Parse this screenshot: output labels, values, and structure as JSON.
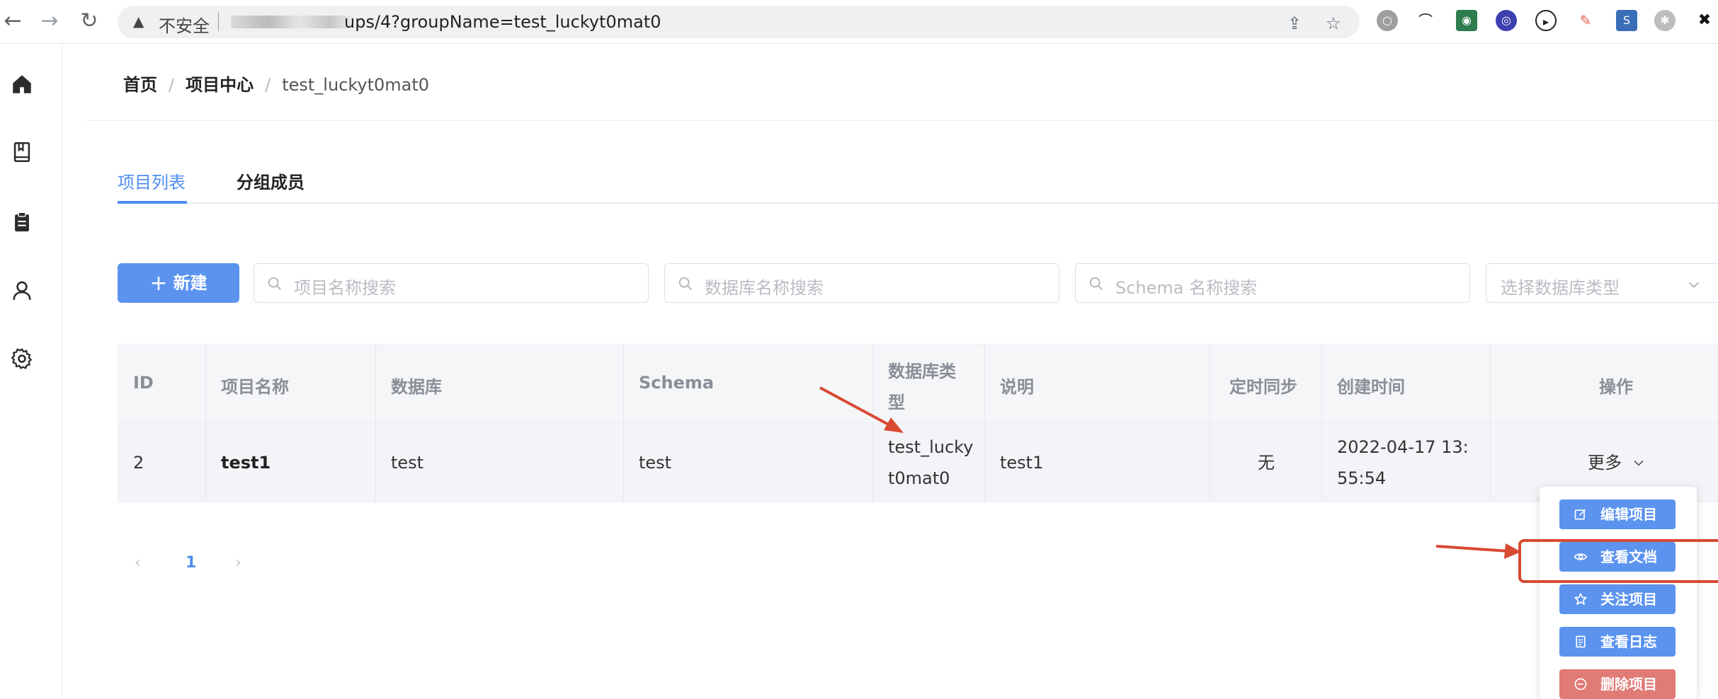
{
  "browser": {
    "insecure_label": "不安全",
    "url_visible": "ups/4?groupName=test_luckyt0mat0"
  },
  "breadcrumb": {
    "home": "首页",
    "project_center": "项目中心",
    "current": "test_luckyt0mat0",
    "separator": "/"
  },
  "tabs": {
    "project_list": "项目列表",
    "group_members": "分组成员"
  },
  "toolbar": {
    "new_label": "新建",
    "search_project_placeholder": "项目名称搜索",
    "search_db_placeholder": "数据库名称搜索",
    "search_schema_placeholder": "Schema 名称搜索",
    "db_type_placeholder": "选择数据库类型"
  },
  "table": {
    "headers": {
      "id": "ID",
      "name": "项目名称",
      "database": "数据库",
      "schema": "Schema",
      "db_type_1": "数据库类",
      "db_type_2": "型",
      "description": "说明",
      "sync": "定时同步",
      "created": "创建时间",
      "actions": "操作"
    },
    "rows": [
      {
        "id": "2",
        "name": "test1",
        "database": "test",
        "schema": "test",
        "db_type_1": "test_lucky",
        "db_type_2": "t0mat0",
        "description": "test1",
        "sync": "无",
        "created_1": "2022-04-17 13:",
        "created_2": "55:54",
        "more": "更多"
      }
    ]
  },
  "pagination": {
    "prev": "‹",
    "current": "1",
    "next": "›"
  },
  "dropdown": {
    "edit": "编辑项目",
    "view_docs": "查看文档",
    "follow": "关注项目",
    "view_logs": "查看日志",
    "delete": "删除项目"
  },
  "colors": {
    "primary": "#5b93ef",
    "danger": "#e07b76",
    "annotation": "#d84a32"
  }
}
